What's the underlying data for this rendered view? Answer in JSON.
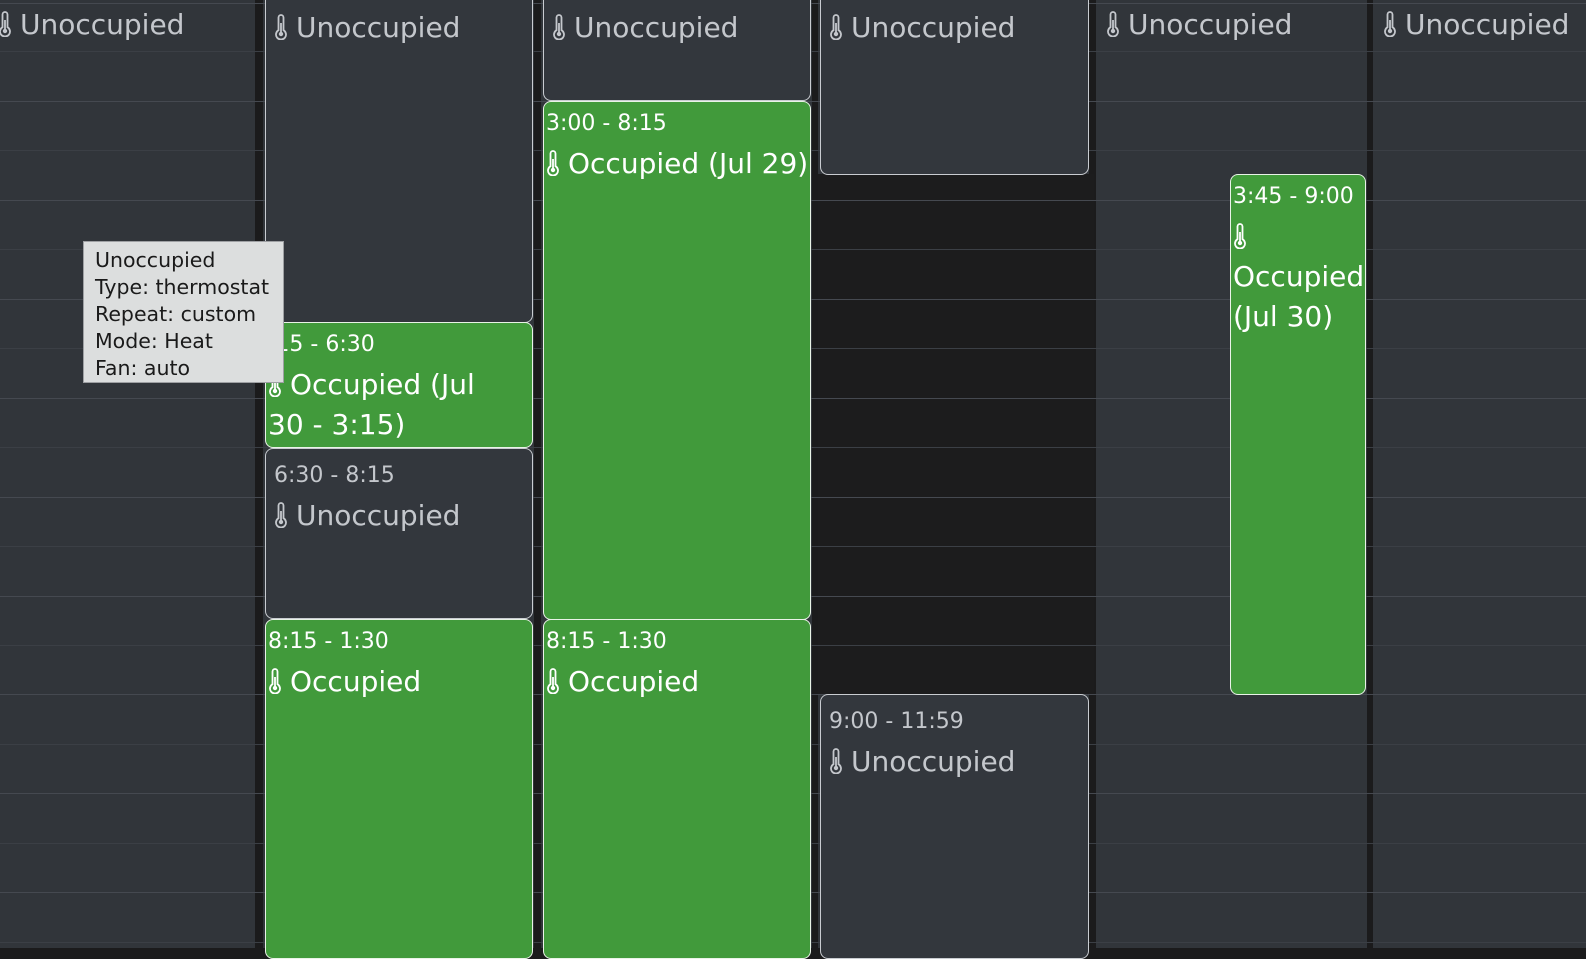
{
  "colors": {
    "occupied": "#419a3b",
    "unoccupied": "#33373d",
    "background": "#1b1b1c"
  },
  "icons": {
    "event_icon": "thermometer-icon"
  },
  "columns": [
    {
      "header": "Unoccupied"
    },
    {
      "header": "Unoccupied"
    },
    {
      "header": "Unoccupied"
    },
    {
      "header": "Unoccupied"
    },
    {
      "header": "Unoccupied"
    },
    {
      "header": "Unoccupied"
    }
  ],
  "events": {
    "col1_occupied_a": {
      "time": ":15 - 6:30",
      "title": "Occupied (Jul 30 - 3:15)"
    },
    "col1_unoccupied": {
      "time": "6:30 - 8:15",
      "title": "Unoccupied"
    },
    "col1_occupied_b": {
      "time": "8:15 - 1:30",
      "title": "Occupied"
    },
    "col2_occupied_a": {
      "time": "3:00 - 8:15",
      "title": "Occupied (Jul 29)"
    },
    "col2_occupied_b": {
      "time": "8:15 - 1:30",
      "title": "Occupied"
    },
    "col3_unoccupied": {
      "time": "9:00 - 11:59",
      "title": "Unoccupied"
    },
    "col4_occupied": {
      "time": "3:45 - 9:00",
      "title": "Occupied (Jul 30)"
    }
  },
  "tooltip": {
    "title": "Unoccupied",
    "type": "Type: thermostat",
    "repeat": "Repeat: custom",
    "mode": "Mode: Heat",
    "fan": "Fan: auto"
  }
}
